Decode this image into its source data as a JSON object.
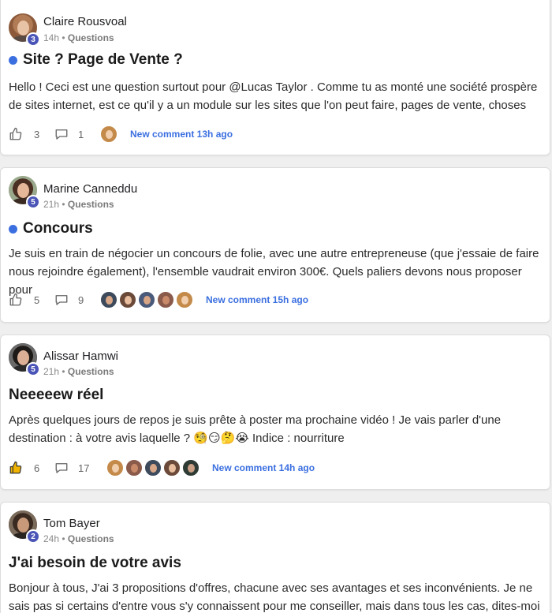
{
  "posts": [
    {
      "author": "Claire Rousvoal",
      "level": "3",
      "time": "14h",
      "category": "Questions",
      "title": "Site ? Page de Vente ?",
      "unread": true,
      "body": "Hello ! Ceci est une question surtout pour @Lucas Taylor . Comme tu as monté une société prospère de sites internet, est ce qu'il y a un module sur les sites que l'on peut faire, pages de vente, choses",
      "likes": "3",
      "comments": "1",
      "new_comment": "New comment 13h ago",
      "liked": false
    },
    {
      "author": "Marine Canneddu",
      "level": "5",
      "time": "21h",
      "category": "Questions",
      "title": "Concours",
      "unread": true,
      "body": "Je suis en train de négocier un concours de folie, avec une autre entrepreneuse (que j'essaie de faire nous rejoindre également), l'ensemble vaudrait environ 300€. Quels paliers devons nous proposer pour",
      "likes": "5",
      "comments": "9",
      "new_comment": "New comment 15h ago",
      "liked": false
    },
    {
      "author": "Alissar Hamwi",
      "level": "5",
      "time": "21h",
      "category": "Questions",
      "title": "Neeeeew réel",
      "unread": false,
      "body": "Après quelques jours de repos je suis prête à poster ma prochaine vidéo ! Je vais parler d'une destination : à votre avis laquelle ? 🧐😏🤔😭 Indice : nourriture",
      "likes": "6",
      "comments": "17",
      "new_comment": "New comment 14h ago",
      "liked": true
    },
    {
      "author": "Tom Bayer",
      "level": "2",
      "time": "24h",
      "category": "Questions",
      "title": "J'ai besoin de votre avis",
      "unread": false,
      "body": "Bonjour à tous, J'ai 3 propositions d'offres, chacune avec ses avantages et ses inconvénients. Je ne sais pas si certains d'entre vous s'y connaissent pour me conseiller, mais dans tous les cas, dites-moi"
    }
  ],
  "separator": "•",
  "colors": {
    "accent": "#3b6fe0",
    "badge": "#4a55b7",
    "liked": "#f0b400"
  },
  "icons": {
    "like": "thumbs-up-icon",
    "comment": "comment-bubble-icon",
    "unread": "unread-dot-icon"
  }
}
